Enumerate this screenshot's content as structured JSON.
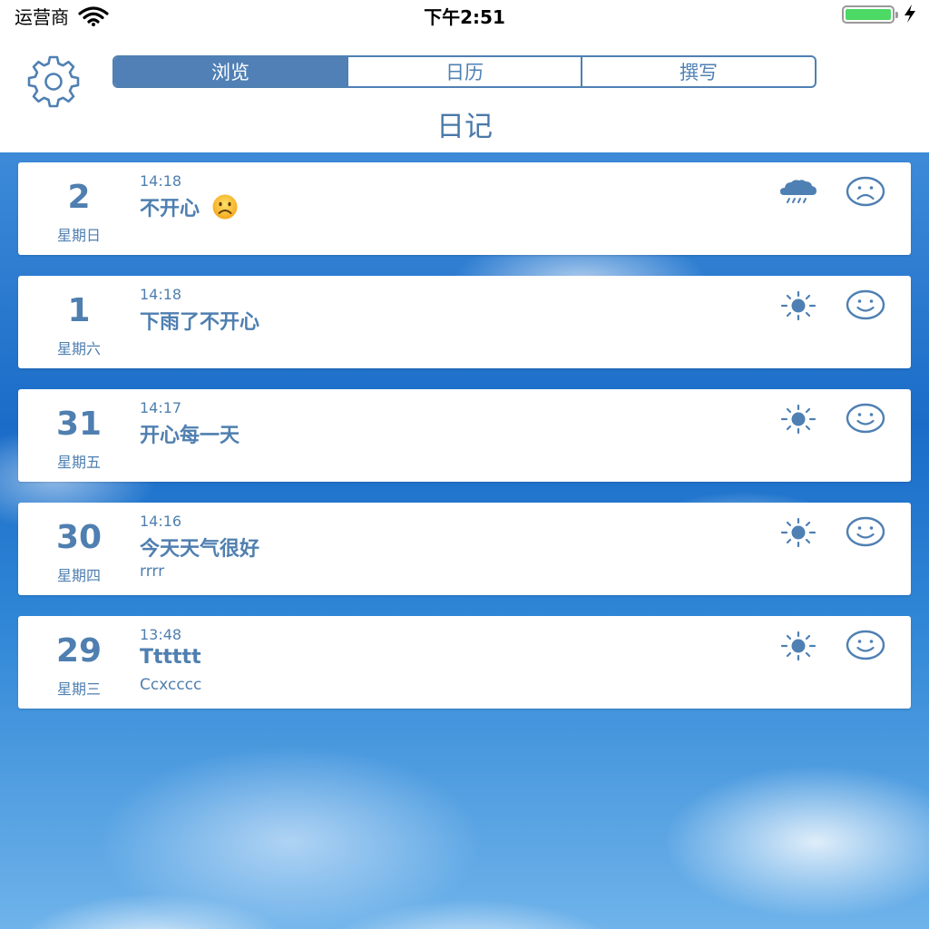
{
  "status_bar": {
    "carrier": "运营商",
    "time": "下午2:51",
    "battery_level": 1.0
  },
  "nav": {
    "settings_icon": "gear-icon",
    "tabs": [
      {
        "label": "浏览",
        "active": true
      },
      {
        "label": "日历",
        "active": false
      },
      {
        "label": "撰写",
        "active": false
      }
    ],
    "title": "日记"
  },
  "colors": {
    "accent": "#4f80b3",
    "sky": "#1a6cc8"
  },
  "entries": [
    {
      "day": "2",
      "weekday": "星期日",
      "time": "14:18",
      "title": "不开心",
      "title_emoji": "frowning-face-emoji",
      "body": "",
      "weather": "rain-cloud-icon",
      "mood": "sad-face-icon"
    },
    {
      "day": "1",
      "weekday": "星期六",
      "time": "14:18",
      "title": "下雨了不开心",
      "body": "",
      "weather": "sun-icon",
      "mood": "smile-face-icon"
    },
    {
      "day": "31",
      "weekday": "星期五",
      "time": "14:17",
      "title": "开心每一天",
      "body": "",
      "weather": "sun-icon",
      "mood": "smile-face-icon"
    },
    {
      "day": "30",
      "weekday": "星期四",
      "time": "14:16",
      "title": "今天天气很好",
      "body": "rrrr",
      "weather": "sun-icon",
      "mood": "smile-face-icon"
    },
    {
      "day": "29",
      "weekday": "星期三",
      "time": "13:48",
      "title": "Tttttt",
      "body": "Ccxcccc",
      "weather": "sun-icon",
      "mood": "smile-face-icon"
    }
  ]
}
